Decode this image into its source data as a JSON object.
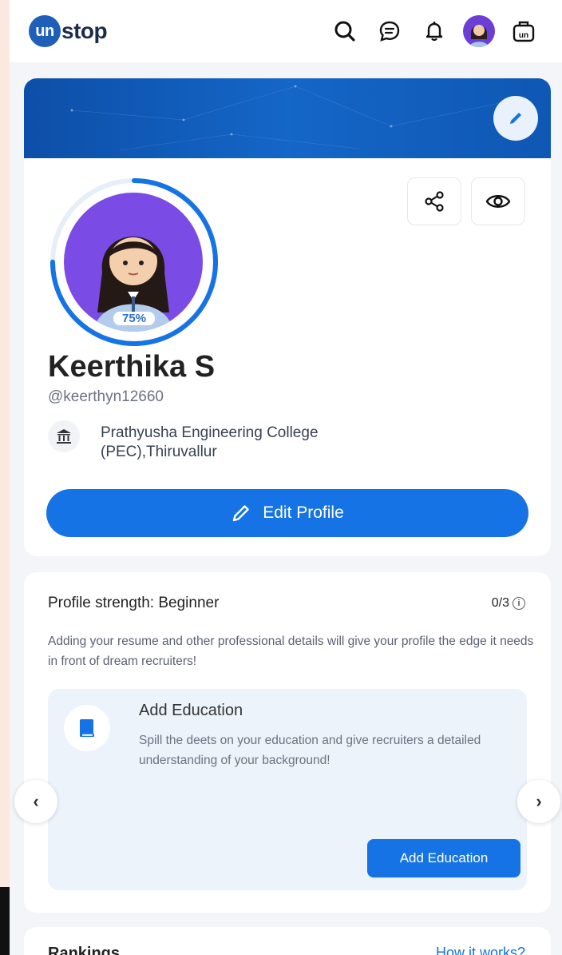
{
  "header": {
    "logo_badge": "un",
    "logo_text": "stop",
    "icons": [
      "search-icon",
      "chat-icon",
      "bell-icon",
      "avatar",
      "briefcase-icon"
    ],
    "briefcase_label": "un"
  },
  "profile": {
    "completion": "75%",
    "completion_value": 75,
    "name": "Keerthika S",
    "handle": "@keerthyn12660",
    "college_line1": "Prathyusha Engineering College",
    "college_line2": "(PEC),Thiruvallur",
    "edit_label": "Edit Profile"
  },
  "strength": {
    "title": "Profile strength: Beginner",
    "count": "0/3",
    "info_glyph": "i",
    "description": "Adding your resume and other professional details will give your profile the edge it needs in front of dream recruiters!",
    "card": {
      "title": "Add Education",
      "description": "Spill the deets on your education and give recruiters a detailed understanding of your background!",
      "button_label": "Add Education"
    },
    "prev_glyph": "‹",
    "next_glyph": "›"
  },
  "rankings": {
    "title": "Rankings",
    "link": "How it works?"
  },
  "colors": {
    "primary": "#1573e6",
    "banner": "#0f57b4",
    "avatar_bg": "#7b4be6"
  }
}
